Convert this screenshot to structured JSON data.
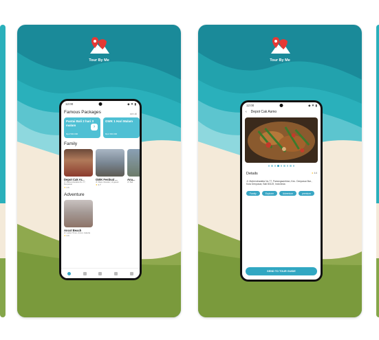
{
  "colors": {
    "teal_dark": "#1a8a99",
    "teal_mid": "#2ab0bb",
    "teal_light": "#7fd4db",
    "sand": "#f4ead9",
    "grass": "#85a64a",
    "accent": "#3aa6c4"
  },
  "brand": {
    "name": "Tour By Me",
    "logo_icon": "map-pin-mountain-icon"
  },
  "screen1": {
    "status_time": "12:00",
    "status_icons": "◆ ▼ ▮",
    "famous_title": "Famous Packages",
    "see_all": "see all",
    "packages": [
      {
        "title": "Pantai Bali 2 hari 3 malam",
        "price": "Rp2.500.000"
      },
      {
        "title": "GWK 1 Hari Malam",
        "price": "Rp1.500.000"
      }
    ],
    "family_title": "Family",
    "family_places": [
      {
        "name": "Depot Cak Ar...",
        "addr": "Jl. Mahendradatta No.77, Denpasar",
        "rating": "4.6"
      },
      {
        "name": "GWK Festival ...",
        "addr": "Jl. Raya Uluwatu, Ungasan",
        "rating": "4.7"
      },
      {
        "name": "Ana...",
        "addr": "Jl. Bali",
        "rating": "4.5"
      }
    ],
    "adventure_title": "Adventure",
    "adventure_places": [
      {
        "name": "Ancol Beach",
        "addr": "Jl. Lodan Timur, Ancol, Jakarta",
        "rating": "4.6"
      }
    ]
  },
  "screen2": {
    "status_time": "12:00",
    "back_icon": "back-arrow-icon",
    "place_title": "Depot Cak Asmo",
    "details_label": "Details",
    "rating": "4.6",
    "address": "Jl. Mahendradatta No.77, Padangsambian, Kec. Denpasar Bar., Kota Denpasar, Bali 80119, Indonesia",
    "tags": [
      "Family",
      "Explorer",
      "Adventure",
      "premium"
    ],
    "send_button": "SEND TO TOUR GUIDE"
  }
}
